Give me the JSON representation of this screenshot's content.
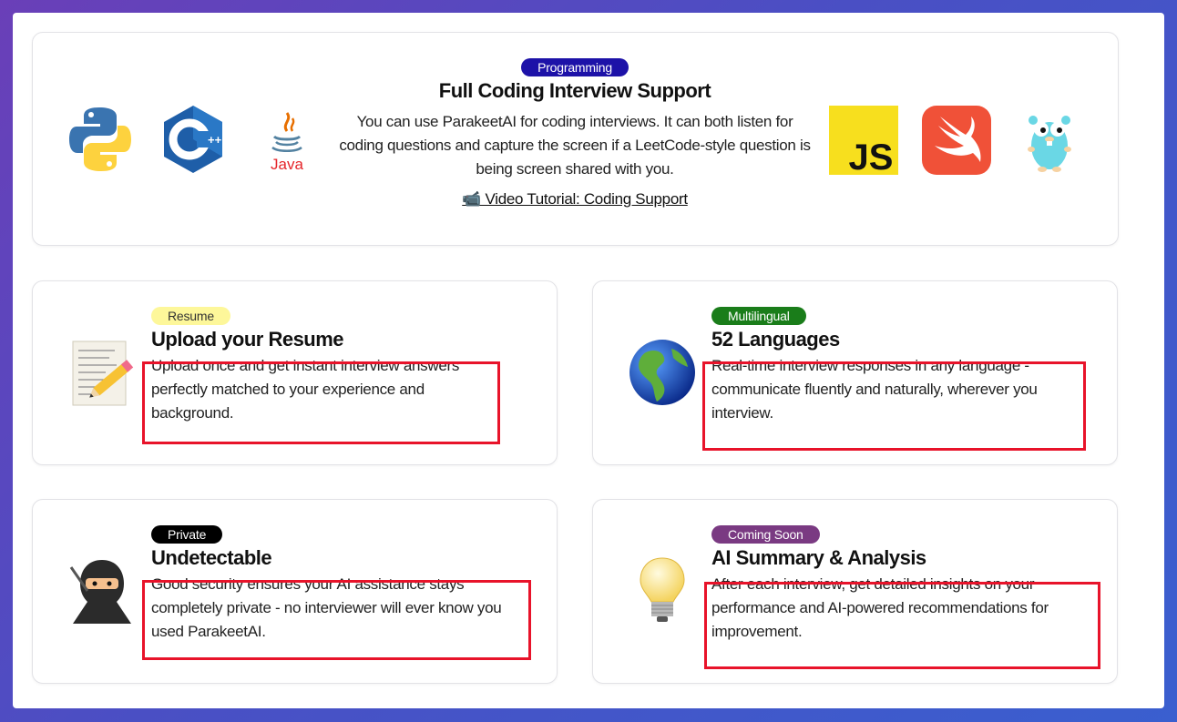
{
  "top": {
    "badge": "Programming",
    "title": "Full Coding Interview Support",
    "description": "You can use ParakeetAI for coding interviews. It can both listen for coding questions and capture the screen if a LeetCode-style question is being screen shared with you.",
    "link": "📹 Video Tutorial: Coding Support",
    "logos": [
      "python-logo",
      "cpp-logo",
      "java-logo",
      "javascript-logo",
      "swift-logo",
      "go-gopher-logo"
    ],
    "java_text": "Java",
    "js_text": "JS",
    "cpp_text": "C",
    "cpp_plus": "++"
  },
  "features": [
    {
      "badge": "Resume",
      "title": "Upload your Resume",
      "description": "Upload once and get instant interview answers perfectly matched to your experience and background.",
      "icon": "memo-pencil-icon"
    },
    {
      "badge": "Multilingual",
      "title": "52 Languages",
      "description": "Real-time interview responses in any language - communicate fluently and naturally, wherever you interview.",
      "icon": "globe-icon"
    },
    {
      "badge": "Private",
      "title": "Undetectable",
      "description": "Good security ensures your AI assistance stays completely private - no interviewer will ever know you used ParakeetAI.",
      "icon": "ninja-icon"
    },
    {
      "badge": "Coming Soon",
      "title": "AI Summary & Analysis",
      "description": "After each interview, get detailed insights on your performance and AI-powered recommendations for improvement.",
      "icon": "lightbulb-icon"
    }
  ],
  "colors": {
    "highlight": "#e8132a",
    "programming_badge": "#1d12a8",
    "resume_badge": "#fdf79a",
    "multilingual_badge": "#1a7d1a",
    "private_badge": "#000000",
    "coming_soon_badge": "#7a3a82"
  }
}
